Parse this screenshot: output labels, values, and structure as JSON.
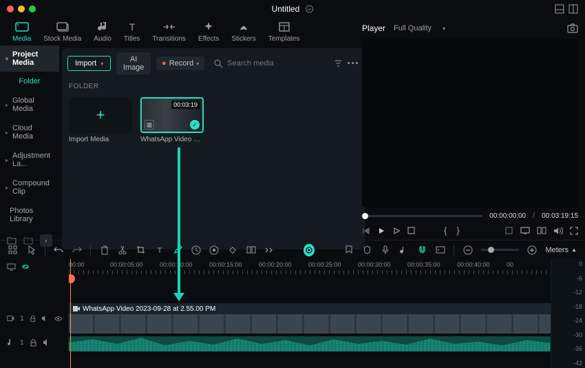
{
  "titlebar": {
    "title": "Untitled"
  },
  "nav": {
    "tabs": [
      {
        "label": "Media"
      },
      {
        "label": "Stock Media"
      },
      {
        "label": "Audio"
      },
      {
        "label": "Titles"
      },
      {
        "label": "Transitions"
      },
      {
        "label": "Effects"
      },
      {
        "label": "Stickers"
      },
      {
        "label": "Templates"
      }
    ]
  },
  "sidebar": {
    "header": "Project Media",
    "folder_label": "Folder",
    "items": [
      {
        "label": "Global Media"
      },
      {
        "label": "Cloud Media"
      },
      {
        "label": "Adjustment La..."
      },
      {
        "label": "Compound Clip"
      },
      {
        "label": "Photos Library"
      }
    ]
  },
  "content": {
    "import_label": "Import",
    "ai_image_label": "AI Image",
    "record_label": "Record",
    "search_placeholder": "Search media",
    "section_label": "FOLDER",
    "thumbs": [
      {
        "label": "Import Media"
      },
      {
        "label": "WhatsApp Video 202...",
        "duration": "00:03:19"
      }
    ]
  },
  "player": {
    "label": "Player",
    "quality": "Full Quality",
    "current_time": "00:00:00:00",
    "total_time": "00:03:19:15"
  },
  "timeline": {
    "meters_label": "Meters",
    "ruler_marks": [
      "00:00",
      "00:00:05:00",
      "00:00:10:00",
      "00:00:15:00",
      "00:00:20:00",
      "00:00:25:00",
      "00:00:30:00",
      "00:00:35:00",
      "00:00:40:00",
      "00"
    ],
    "track_headers": {
      "video": "1",
      "audio": "1"
    },
    "clip_name": "WhatsApp Video 2023-09-28 at 2.55.00 PM",
    "meter_scale": [
      "0",
      "-6",
      "-12",
      "-18",
      "-24",
      "-30",
      "-36",
      "-42"
    ]
  }
}
